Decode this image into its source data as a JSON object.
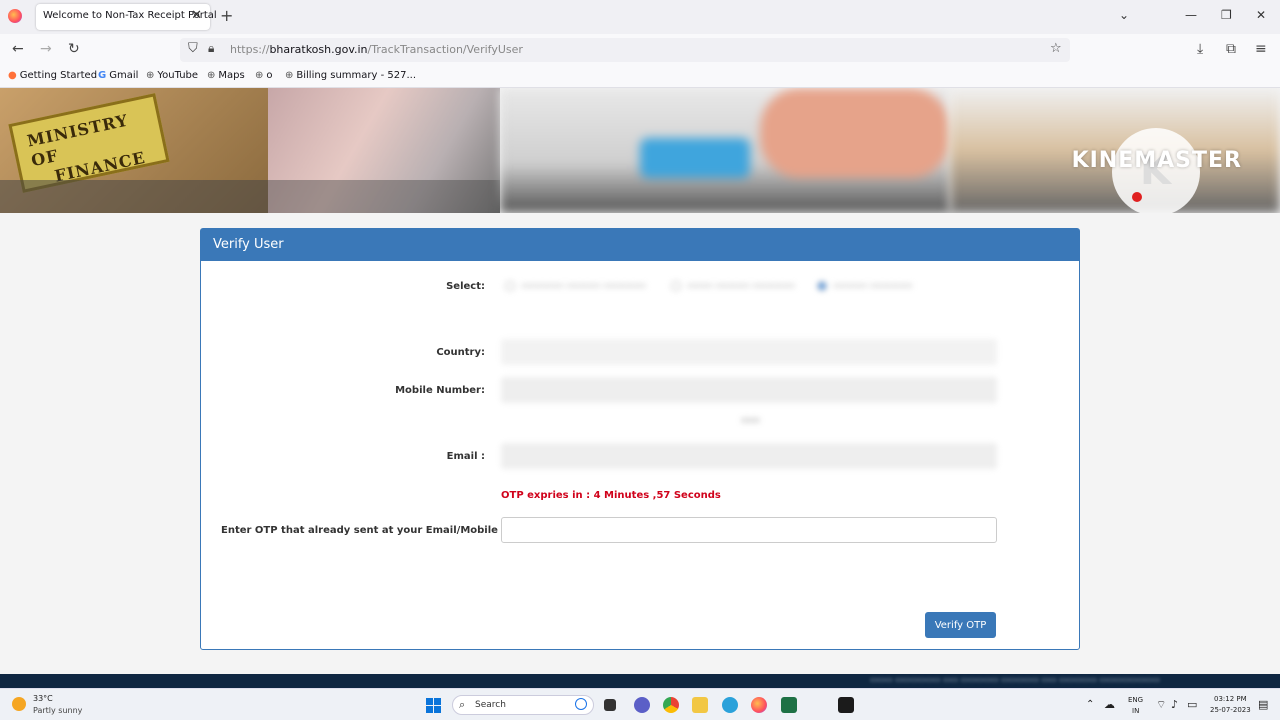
{
  "browser": {
    "tab_title": "Welcome to Non-Tax Receipt Portal",
    "url_prefix": "https://",
    "url_host": "bharatkosh.gov.in",
    "url_path": "/TrackTransaction/VerifyUser",
    "bookmarks": [
      "Getting Started",
      "Gmail",
      "YouTube",
      "Maps",
      "o",
      "Billing summary - 527..."
    ]
  },
  "banner": {
    "ministry_line1": "MINISTRY OF",
    "ministry_line2": "FINANCE",
    "watermark": "KINEMASTER"
  },
  "form": {
    "title": "Verify User",
    "select_label": "Select:",
    "country_label": "Country:",
    "mobile_label": "Mobile Number:",
    "email_label": "Email :",
    "otp_expiry": "OTP expries in : 4 Minutes ,57 Seconds",
    "otp_label": "Enter OTP that already sent at your Email/Mobile",
    "otp_value": "",
    "verify_button": "Verify OTP"
  },
  "taskbar": {
    "temperature": "33°C",
    "weather": "Partly sunny",
    "search_label": "Search",
    "lang_line1": "ENG",
    "lang_line2": "IN",
    "time": "03:12 PM",
    "date": "25-07-2023"
  },
  "colors": {
    "header_blue": "#3a78b8",
    "expiry_red": "#d0021b",
    "footer_navy": "#0f2742"
  }
}
